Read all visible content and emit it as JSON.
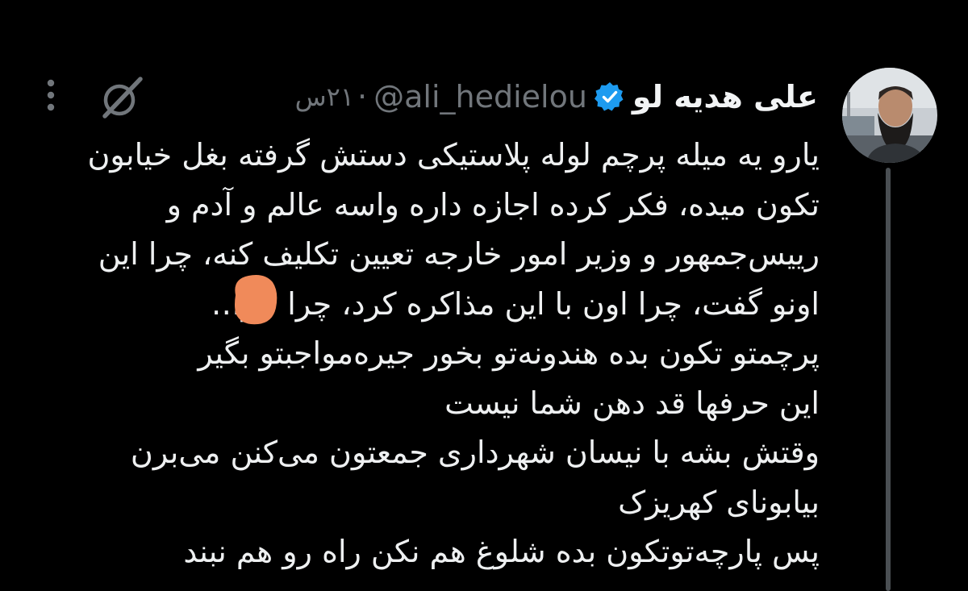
{
  "tweet": {
    "author": {
      "display_name": "علی هدیه لو",
      "handle": "@ali_hedielou",
      "verified": true,
      "avatar_icon": "profile-photo"
    },
    "separator": "·",
    "timestamp": "۲۱س",
    "actions": {
      "grok_icon": "grok-icon",
      "more_icon": "vertical-dots-icon"
    },
    "text_lines": [
      "یارو یه میله پرچم لوله پلاستیکی دستش گرفته بغل خیابون",
      "تکون میده، فکر کرده اجازه داره واسه عالم و آدم و",
      "رییس‌جمهور و وزیر امور خارجه تعیین تکلیف کنه، چرا این",
      "اونو گفت، چرا اون با این مذاکره کرد، چرا    خر…",
      "پرچمتو تکون بده هندونه‌تو بخور جیره‌مواجبتو بگیر",
      "این حرفها قد دهن شما نیست",
      "وقتش بشه با نیسان شهرداری جمعتون می‌کنن می‌برن",
      "بیابونای کهریزک",
      "پس پارچه‌توتکون بده شلوغ هم نکن راه رو هم نبند"
    ],
    "colors": {
      "background": "#000000",
      "text": "#e7e9ea",
      "muted": "#71767b",
      "verified": "#1d9bf0",
      "redaction": "#f08a5a"
    }
  }
}
